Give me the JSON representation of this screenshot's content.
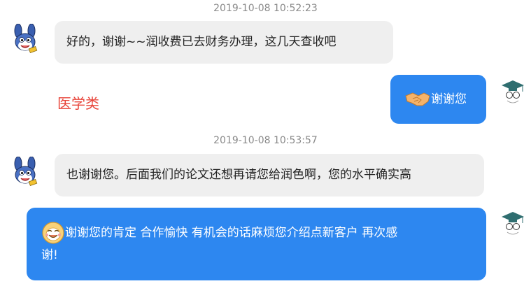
{
  "messages": [
    {
      "timestamp": "2019-10-08 10:52:23",
      "sender": "rabbit",
      "text": "好的，谢谢~~润收费已去财务办理，这几天查收吧"
    },
    {
      "sender": "self",
      "emoji": "handshake-emoji",
      "text": "谢谢您"
    },
    {
      "timestamp": "2019-10-08 10:53:57",
      "sender": "rabbit",
      "text": "也谢谢您。后面我们的论文还想再请您给润色啊，您的水平确实高"
    },
    {
      "sender": "self",
      "emoji": "smile-emoji",
      "text_line1": "谢谢您的肯定 合作愉快 有机会的话麻烦您介绍点新客户 再次感",
      "text_line2": "谢!"
    }
  ],
  "tag_label": "医学类",
  "colors": {
    "incoming_bubble": "#efefef",
    "outgoing_bubble": "#2d87f0",
    "tag_text": "#e8443a",
    "timestamp_text": "#8a8a8a"
  },
  "icons": {
    "left_avatar": "rabbit-avatar-icon",
    "right_avatar": "graduate-avatar-icon"
  }
}
